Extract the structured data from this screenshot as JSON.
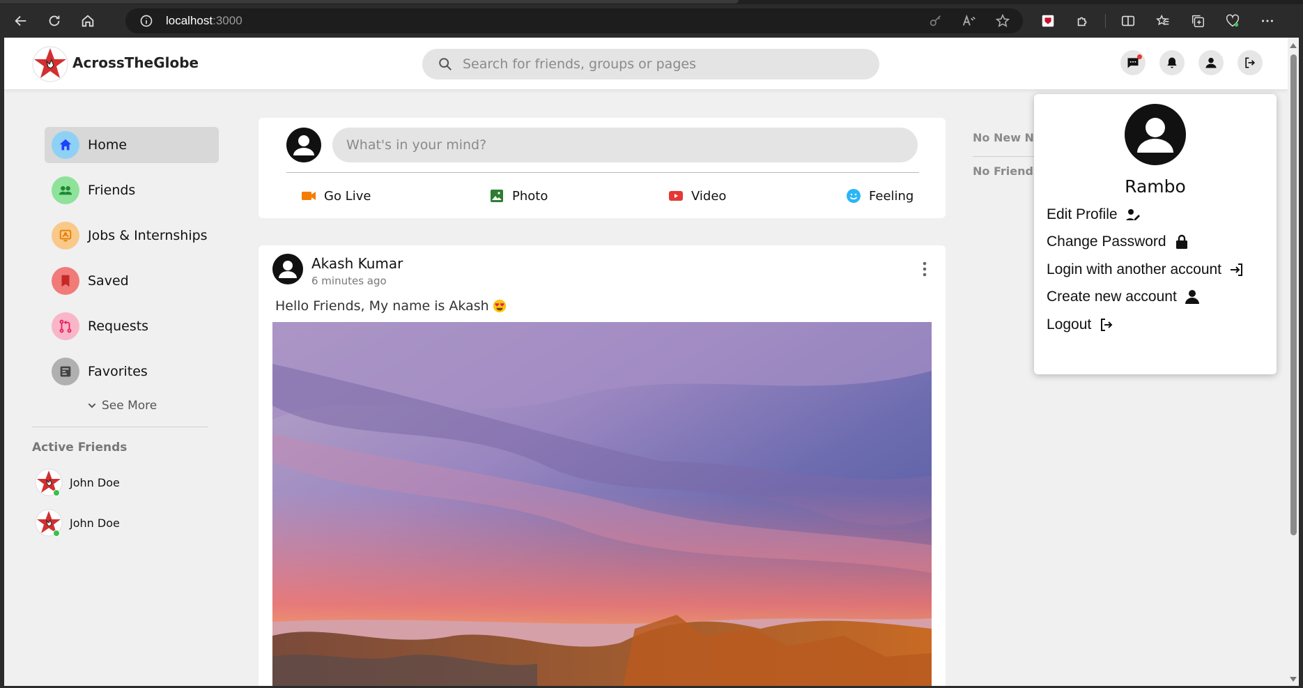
{
  "browser": {
    "url_host": "localhost",
    "url_port": ":3000"
  },
  "header": {
    "brand": "AcrossTheGlobe",
    "search_placeholder": "Search for friends, groups or pages",
    "icons": [
      "messages-icon",
      "notifications-icon",
      "profile-icon",
      "logout-icon"
    ]
  },
  "sidebar": {
    "items": [
      {
        "label": "Home",
        "icon": "home-icon",
        "color": "#2196f3"
      },
      {
        "label": "Friends",
        "icon": "friends-icon",
        "color": "#2e9e44"
      },
      {
        "label": "Jobs & Internships",
        "icon": "jobs-icon",
        "color": "#f5a623"
      },
      {
        "label": "Saved",
        "icon": "bookmark-icon",
        "color": "#e53935"
      },
      {
        "label": "Requests",
        "icon": "requests-icon",
        "color": "#e91e63"
      },
      {
        "label": "Favorites",
        "icon": "favorites-icon",
        "color": "#555555"
      }
    ],
    "see_more": "See More",
    "active_friends_title": "Active Friends",
    "active_friends": [
      {
        "name": "John Doe"
      },
      {
        "name": "John Doe"
      }
    ]
  },
  "create_post": {
    "placeholder": "What's in your mind?",
    "actions": [
      {
        "label": "Go Live",
        "color": "#f57c00"
      },
      {
        "label": "Photo",
        "color": "#2e7d32"
      },
      {
        "label": "Video",
        "color": "#e53935"
      },
      {
        "label": "Feeling",
        "color": "#29b6f6"
      }
    ]
  },
  "post": {
    "author": "Akash Kumar",
    "time": "6 minutes ago",
    "text": "Hello Friends, My name is Akash"
  },
  "right_column": {
    "notifications": "No New No",
    "friend_requests": "No Friend"
  },
  "profile_menu": {
    "name": "Rambo",
    "items": [
      {
        "label": "Edit Profile",
        "icon": "edit-user-icon"
      },
      {
        "label": "Change Password",
        "icon": "lock-icon"
      },
      {
        "label": "Login with another account",
        "icon": "login-icon"
      },
      {
        "label": "Create new account",
        "icon": "user-icon"
      },
      {
        "label": "Logout",
        "icon": "logout-icon"
      }
    ]
  }
}
